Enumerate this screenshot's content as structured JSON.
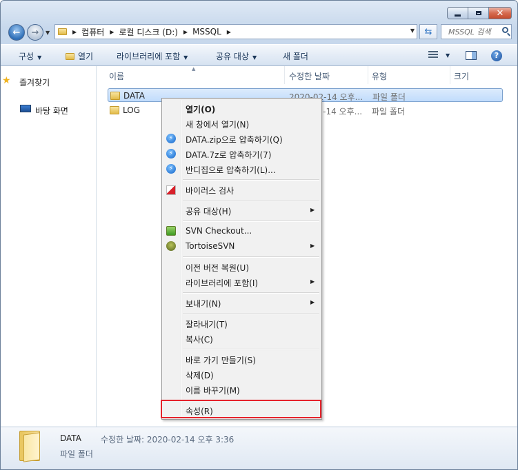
{
  "window": {
    "address": {
      "crumbs": [
        "컴퓨터",
        "로컬 디스크 (D:)",
        "MSSQL"
      ]
    },
    "search": {
      "placeholder": "MSSQL 검색"
    }
  },
  "toolbar": {
    "organize": "구성",
    "open": "열기",
    "include_library": "라이브러리에 포함",
    "share_with": "공유 대상",
    "new_folder": "새 폴더"
  },
  "navpane": {
    "favorites": "즐겨찾기",
    "desktop": "바탕 화면"
  },
  "columns": {
    "name": "이름",
    "date_modified": "수정한 날짜",
    "type": "유형",
    "size": "크기"
  },
  "files": [
    {
      "name": "DATA",
      "date": "2020-02-14 오후...",
      "type": "파일 폴더"
    },
    {
      "name": "LOG",
      "date": "2020-02-14 오후...",
      "type": "파일 폴더"
    }
  ],
  "context_menu": {
    "open": "열기(O)",
    "open_new_window": "새 창에서 열기(N)",
    "zip": "DATA.zip으로 압축하기(Q)",
    "sevenz": "DATA.7z로 압축하기(7)",
    "bandizip": "반디집으로 압축하기(L)...",
    "virus_scan": "바이러스 검사",
    "share_with": "공유 대상(H)",
    "svn_checkout": "SVN Checkout...",
    "tortoisesvn": "TortoiseSVN",
    "restore_previous": "이전 버전 복원(U)",
    "include_library": "라이브러리에 포함(I)",
    "send_to": "보내기(N)",
    "cut": "잘라내기(T)",
    "copy": "복사(C)",
    "create_shortcut": "바로 가기 만들기(S)",
    "delete": "삭제(D)",
    "rename": "이름 바꾸기(M)",
    "properties": "속성(R)"
  },
  "details": {
    "name": "DATA",
    "modified_label": "수정한 날짜: 2020-02-14 오후 3:36",
    "type": "파일 폴더"
  },
  "colors": {
    "highlight_border": "#e5222b",
    "selection_border": "#7da2ce"
  }
}
